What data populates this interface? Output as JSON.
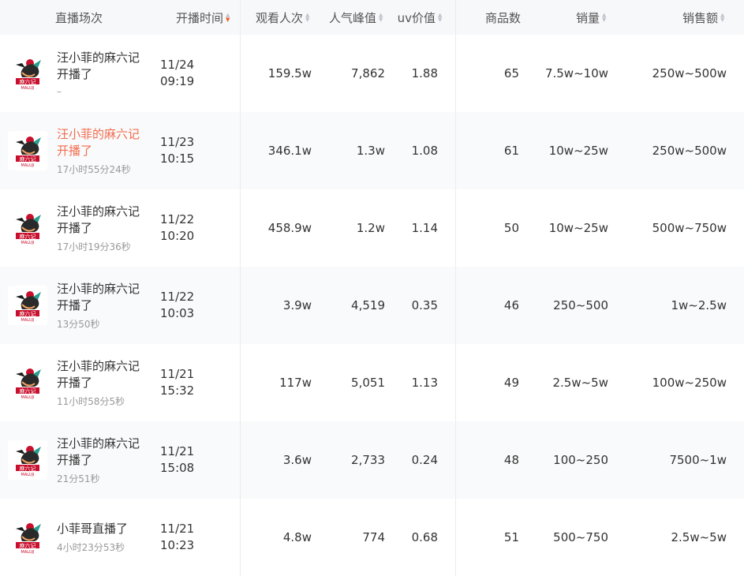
{
  "columns": {
    "live": "直播场次",
    "time": "开播时间",
    "views": "观看人次",
    "peak": "人气峰值",
    "uv": "uv价值",
    "goods": "商品数",
    "sales": "销量",
    "amount": "销售额"
  },
  "colors": {
    "accent": "#f26d4f",
    "sort_active": "#f15a24"
  },
  "logo_icon": "maluji-rooster-logo",
  "rows": [
    {
      "title": "汪小菲的麻六记开播了",
      "duration": "–",
      "date": "11/24",
      "clock": "09:19",
      "views": "159.5w",
      "peak": "7,862",
      "uv": "1.88",
      "goods": "65",
      "sales": "7.5w~10w",
      "amount": "250w~500w",
      "highlight": false
    },
    {
      "title": "汪小菲的麻六记开播了",
      "duration": "17小时55分24秒",
      "date": "11/23",
      "clock": "10:15",
      "views": "346.1w",
      "peak": "1.3w",
      "uv": "1.08",
      "goods": "61",
      "sales": "10w~25w",
      "amount": "250w~500w",
      "highlight": true
    },
    {
      "title": "汪小菲的麻六记开播了",
      "duration": "17小时19分36秒",
      "date": "11/22",
      "clock": "10:20",
      "views": "458.9w",
      "peak": "1.2w",
      "uv": "1.14",
      "goods": "50",
      "sales": "10w~25w",
      "amount": "500w~750w",
      "highlight": false
    },
    {
      "title": "汪小菲的麻六记开播了",
      "duration": "13分50秒",
      "date": "11/22",
      "clock": "10:03",
      "views": "3.9w",
      "peak": "4,519",
      "uv": "0.35",
      "goods": "46",
      "sales": "250~500",
      "amount": "1w~2.5w",
      "highlight": false
    },
    {
      "title": "汪小菲的麻六记开播了",
      "duration": "11小时58分5秒",
      "date": "11/21",
      "clock": "15:32",
      "views": "117w",
      "peak": "5,051",
      "uv": "1.13",
      "goods": "49",
      "sales": "2.5w~5w",
      "amount": "100w~250w",
      "highlight": false
    },
    {
      "title": "汪小菲的麻六记开播了",
      "duration": "21分51秒",
      "date": "11/21",
      "clock": "15:08",
      "views": "3.6w",
      "peak": "2,733",
      "uv": "0.24",
      "goods": "48",
      "sales": "100~250",
      "amount": "7500~1w",
      "highlight": false
    },
    {
      "title": "小菲哥直播了",
      "duration": "4小时23分53秒",
      "date": "11/21",
      "clock": "10:23",
      "views": "4.8w",
      "peak": "774",
      "uv": "0.68",
      "goods": "51",
      "sales": "500~750",
      "amount": "2.5w~5w",
      "highlight": false
    }
  ]
}
